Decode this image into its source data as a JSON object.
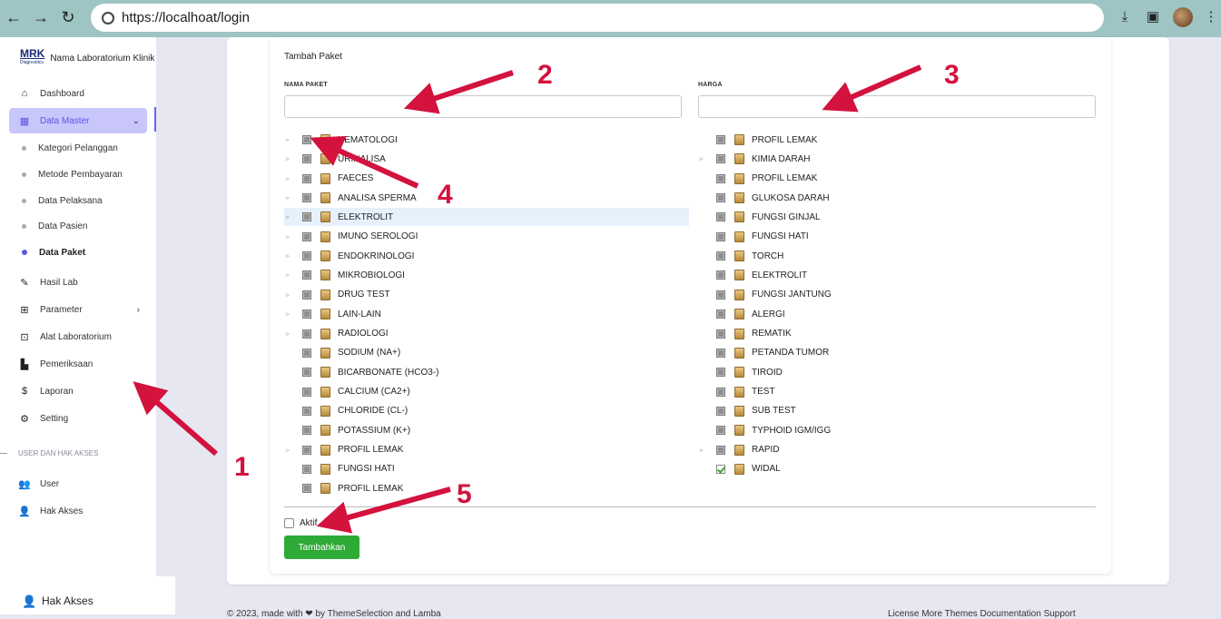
{
  "browser": {
    "url": "https://localhoat/login"
  },
  "sidebar": {
    "brand_logo": "MRK",
    "brand_logo_sub": "Diagnostics",
    "brand_name": "Nama Laboratorium Klinik",
    "items": [
      {
        "label": "Dashboard",
        "icon": "home-icon"
      },
      {
        "label": "Data Master",
        "icon": "calendar-icon",
        "active": true
      },
      {
        "label": "Hasil Lab",
        "icon": "edit-icon"
      },
      {
        "label": "Parameter",
        "icon": "grid-icon"
      },
      {
        "label": "Alat Laboratorium",
        "icon": "briefcase-icon"
      },
      {
        "label": "Pemeriksaan",
        "icon": "clipboard-user-icon"
      },
      {
        "label": "Laporan",
        "icon": "hand-dollar-icon"
      },
      {
        "label": "Setting",
        "icon": "gear-icon"
      }
    ],
    "sub_items": [
      "Kategori Pelanggan",
      "Metode Pembayaran",
      "Data Pelaksana",
      "Data Pasien",
      "Data Paket"
    ],
    "section_header": "USER DAN HAK AKSES",
    "user_items": [
      {
        "label": "User",
        "icon": "users-icon"
      },
      {
        "label": "Hak Akses",
        "icon": "user-key-icon"
      }
    ]
  },
  "bottom_strip": {
    "label": "Hak Akses"
  },
  "form": {
    "title": "Tambah Paket",
    "nama_paket_label": "NAMA PAKET",
    "harga_label": "HARGA",
    "nama_paket_value": "",
    "harga_value": "",
    "aktif_label": "Aktif",
    "submit_label": "Tambahkan"
  },
  "tree_left": [
    {
      "label": "HEMATOLOGI",
      "expandable": true
    },
    {
      "label": "URINALISA",
      "expandable": true
    },
    {
      "label": "FAECES",
      "expandable": true
    },
    {
      "label": "ANALISA SPERMA",
      "expandable": true
    },
    {
      "label": "ELEKTROLIT",
      "expandable": true,
      "highlight": true
    },
    {
      "label": "IMUNO SEROLOGI",
      "expandable": true
    },
    {
      "label": "ENDOKRINOLOGI",
      "expandable": true
    },
    {
      "label": "MIKROBIOLOGI",
      "expandable": true
    },
    {
      "label": "DRUG TEST",
      "expandable": true
    },
    {
      "label": "LAIN-LAIN",
      "expandable": true
    },
    {
      "label": "RADIOLOGI",
      "expandable": true
    },
    {
      "label": "SODIUM (NA+)",
      "expandable": false
    },
    {
      "label": "BICARBONATE (HCO3-)",
      "expandable": false
    },
    {
      "label": "CALCIUM (CA2+)",
      "expandable": false
    },
    {
      "label": "CHLORIDE (CL-)",
      "expandable": false
    },
    {
      "label": "POTASSIUM (K+)",
      "expandable": false
    },
    {
      "label": "PROFIL LEMAK",
      "expandable": true
    },
    {
      "label": "FUNGSI HATI",
      "expandable": false
    },
    {
      "label": "PROFIL LEMAK",
      "expandable": false
    }
  ],
  "tree_right": [
    {
      "label": "PROFIL LEMAK",
      "expandable": false
    },
    {
      "label": "KIMIA DARAH",
      "expandable": true
    },
    {
      "label": "PROFIL LEMAK",
      "expandable": false
    },
    {
      "label": "GLUKOSA DARAH",
      "expandable": false
    },
    {
      "label": "FUNGSI GINJAL",
      "expandable": false
    },
    {
      "label": "FUNGSI HATI",
      "expandable": false
    },
    {
      "label": "TORCH",
      "expandable": false
    },
    {
      "label": "ELEKTROLIT",
      "expandable": false
    },
    {
      "label": "FUNGSI JANTUNG",
      "expandable": false
    },
    {
      "label": "ALERGI",
      "expandable": false
    },
    {
      "label": "REMATIK",
      "expandable": false
    },
    {
      "label": "PETANDA TUMOR",
      "expandable": false
    },
    {
      "label": "TIROID",
      "expandable": false
    },
    {
      "label": "TEST",
      "expandable": false
    },
    {
      "label": "SUB TEST",
      "expandable": false
    },
    {
      "label": "TYPHOID IGM/IGG",
      "expandable": false
    },
    {
      "label": "RAPID",
      "expandable": true
    },
    {
      "label": "WIDAL",
      "expandable": false,
      "checked": true
    }
  ],
  "footer": {
    "left": "© 2023, made with ❤ by ThemeSelection and Lamba",
    "right": "License   More Themes   Documentation   Support"
  },
  "annotations": [
    "1",
    "2",
    "3",
    "4",
    "5"
  ],
  "colors": {
    "accent": "#6763f0",
    "active_bg": "#c8c6fb",
    "button": "#2eaa36",
    "annotation": "#d3123e",
    "browser_bar": "#9ec4c4"
  }
}
